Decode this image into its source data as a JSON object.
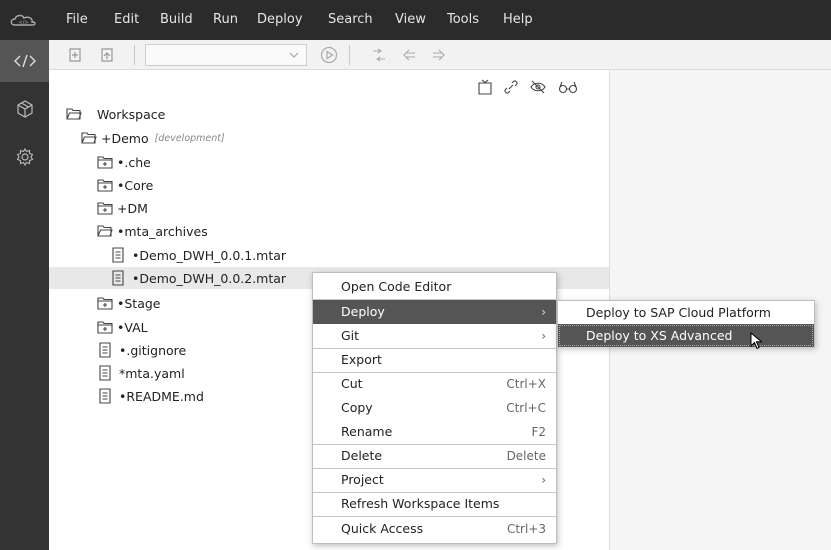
{
  "menubar": {
    "items": [
      "File",
      "Edit",
      "Build",
      "Run",
      "Deploy",
      "Search",
      "View",
      "Tools",
      "Help"
    ]
  },
  "leftbar": {
    "icons": [
      "code-icon",
      "cube-icon",
      "settings-icon"
    ]
  },
  "toolbar": {
    "select_value": ""
  },
  "panel_tools": [
    "collapse-icon",
    "link-icon",
    "hide-icon",
    "glasses-icon"
  ],
  "tree": [
    {
      "label": "Workspace",
      "tag": "",
      "icon": "folder-open-icon"
    },
    {
      "label": "+Demo",
      "tag": "[development]",
      "icon": "folder-open-icon"
    },
    {
      "label": "•.che",
      "tag": "",
      "icon": "folder-closed-icon"
    },
    {
      "label": "•Core",
      "tag": "",
      "icon": "folder-closed-icon"
    },
    {
      "label": "+DM",
      "tag": "",
      "icon": "folder-closed-icon"
    },
    {
      "label": "•mta_archives",
      "tag": "",
      "icon": "folder-open-icon"
    },
    {
      "label": "•Demo_DWH_0.0.1.mtar",
      "tag": "",
      "icon": "file-icon"
    },
    {
      "label": "•Demo_DWH_0.0.2.mtar",
      "tag": "",
      "icon": "file-icon"
    },
    {
      "label": "•Stage",
      "tag": "",
      "icon": "folder-closed-icon"
    },
    {
      "label": "•VAL",
      "tag": "",
      "icon": "folder-closed-icon"
    },
    {
      "label": "•.gitignore",
      "tag": "",
      "icon": "file-icon"
    },
    {
      "label": "*mta.yaml",
      "tag": "",
      "icon": "file-icon"
    },
    {
      "label": "•README.md",
      "tag": "",
      "icon": "file-icon"
    }
  ],
  "context_menu": {
    "items": [
      {
        "label": "Open Code Editor",
        "shortcut": ""
      },
      {
        "label": "Deploy",
        "shortcut": "›"
      },
      {
        "label": "Git",
        "shortcut": "›"
      },
      {
        "label": "Export",
        "shortcut": ""
      },
      {
        "label": "Cut",
        "shortcut": "Ctrl+X"
      },
      {
        "label": "Copy",
        "shortcut": "Ctrl+C"
      },
      {
        "label": "Rename",
        "shortcut": "F2"
      },
      {
        "label": "Delete",
        "shortcut": "Delete"
      },
      {
        "label": "Project",
        "shortcut": "›"
      },
      {
        "label": "Refresh Workspace Items",
        "shortcut": ""
      },
      {
        "label": "Quick Access",
        "shortcut": "Ctrl+3"
      }
    ]
  },
  "submenu": {
    "items": [
      {
        "label": "Deploy to SAP Cloud Platform"
      },
      {
        "label": "Deploy to XS Advanced"
      }
    ]
  }
}
